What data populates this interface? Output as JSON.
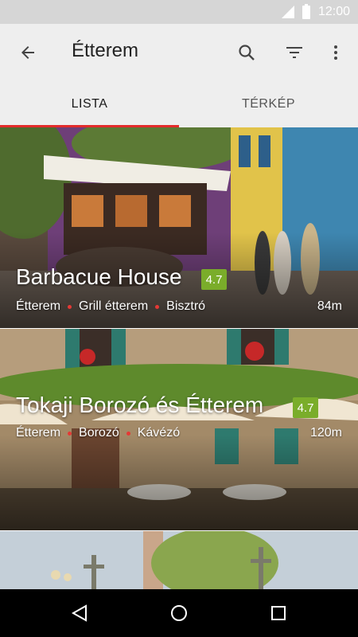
{
  "status_bar": {
    "time": "12:00"
  },
  "app_bar": {
    "title": "Étterem",
    "icons": [
      "back-arrow-icon",
      "search-icon",
      "filter-icon",
      "more-vert-icon"
    ]
  },
  "tabs": [
    {
      "label": "LISTA",
      "active": true
    },
    {
      "label": "TÉRKÉP",
      "active": false
    }
  ],
  "restaurants": [
    {
      "name": "Barbacue House",
      "rating": "4.7",
      "categories": [
        "Étterem",
        "Grill étterem",
        "Bisztró"
      ],
      "distance": "84m"
    },
    {
      "name": "Tokaji Borozó és Étterem",
      "rating": "4.7",
      "categories": [
        "Étterem",
        "Borozó",
        "Kávézó"
      ],
      "distance": "120m"
    }
  ],
  "colors": {
    "accent": "#e32b2b",
    "rating_badge": "#7aad2a",
    "category_dot": "#e53935"
  }
}
